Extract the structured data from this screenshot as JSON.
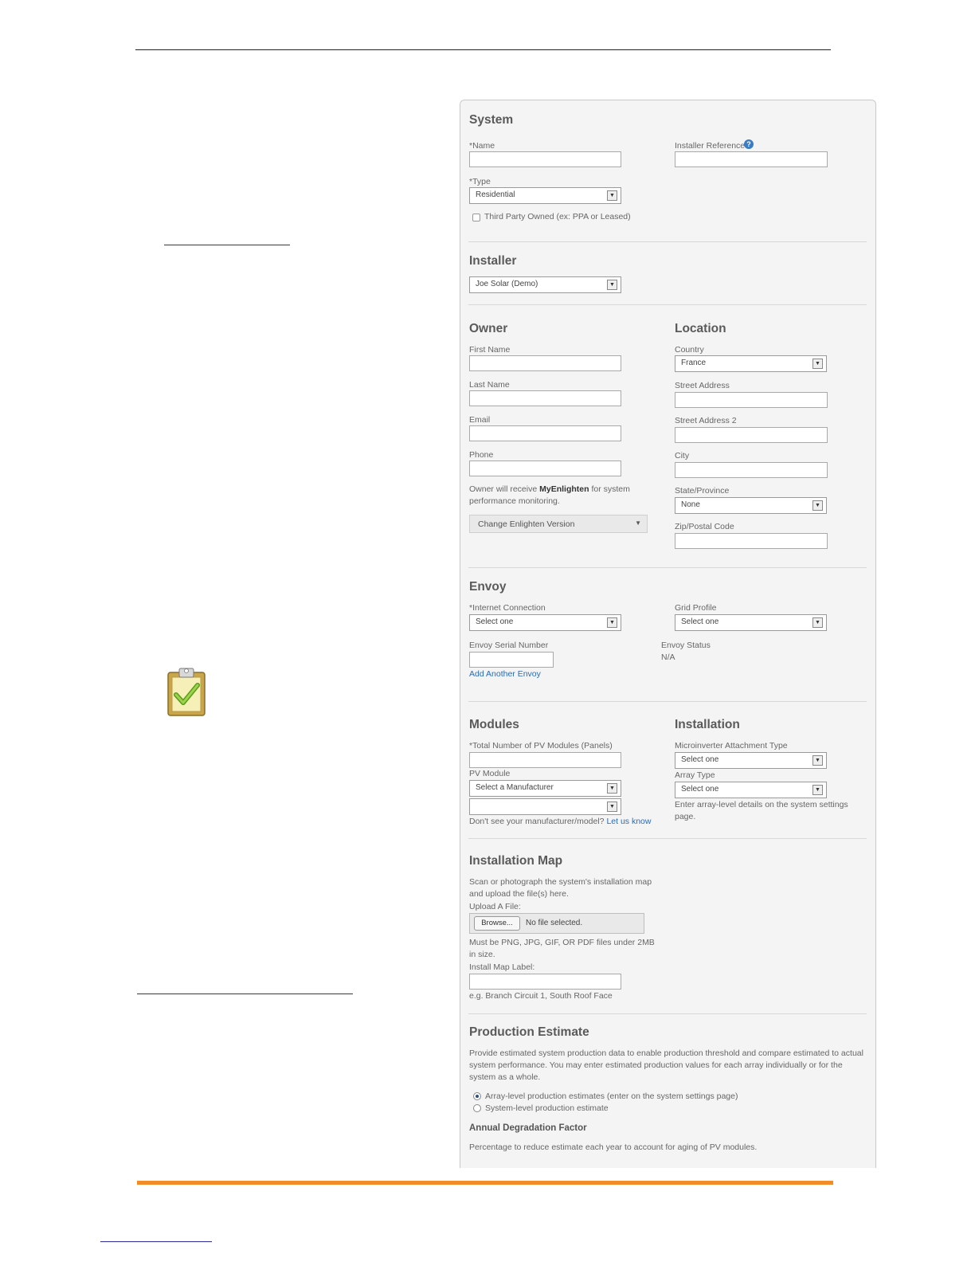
{
  "form": {
    "system": {
      "title": "System",
      "name_label": "*Name",
      "installer_ref_label": "Installer Reference",
      "type_label": "*Type",
      "type_value": "Residential",
      "third_party_label": "Third Party Owned (ex: PPA or Leased)"
    },
    "installer": {
      "title": "Installer",
      "value": "Joe Solar (Demo)"
    },
    "owner": {
      "title": "Owner",
      "first_name_label": "First Name",
      "last_name_label": "Last Name",
      "email_label": "Email",
      "phone_label": "Phone",
      "note_prefix": "Owner will receive ",
      "note_brand": "MyEnlighten",
      "note_suffix": " for system performance monitoring.",
      "change_version_label": "Change Enlighten Version"
    },
    "location": {
      "title": "Location",
      "country_label": "Country",
      "country_value": "France",
      "street_label": "Street Address",
      "street2_label": "Street Address 2",
      "city_label": "City",
      "state_label": "State/Province",
      "state_value": "None",
      "zip_label": "Zip/Postal Code"
    },
    "envoy": {
      "title": "Envoy",
      "internet_label": "*Internet Connection",
      "internet_value": "Select one",
      "grid_label": "Grid Profile",
      "grid_value": "Select one",
      "serial_label": "Envoy Serial Number",
      "status_label": "Envoy Status",
      "status_value": "N/A",
      "add_link": "Add Another Envoy"
    },
    "modules": {
      "title": "Modules",
      "total_label": "*Total Number of PV Modules (Panels)",
      "pv_label": "PV Module",
      "manufacturer_value": "Select a Manufacturer",
      "note": "Don't see your manufacturer/model?",
      "let_us_know": "Let us know"
    },
    "installation": {
      "title": "Installation",
      "attachment_label": "Microinverter Attachment Type",
      "attachment_value": "Select one",
      "array_label": "Array Type",
      "array_value": "Select one",
      "note": "Enter array-level details on the system settings page."
    },
    "installation_map": {
      "title": "Installation Map",
      "desc": "Scan or photograph the system's installation map and upload the file(s) here.",
      "upload_label": "Upload A File:",
      "browse_label": "Browse...",
      "no_file": "No file selected.",
      "size_note": "Must be PNG, JPG, GIF, OR PDF files under 2MB in size.",
      "map_label": "Install Map Label:",
      "example": "e.g. Branch Circuit 1, South Roof Face"
    },
    "production": {
      "title": "Production Estimate",
      "desc": "Provide estimated system production data to enable production threshold and compare estimated to actual system performance. You may enter estimated production values for each array individually or for the system as a whole.",
      "opt_array": "Array-level production estimates (enter on the system settings page)",
      "opt_system": "System-level production estimate",
      "degradation_title": "Annual Degradation Factor",
      "degradation_desc": "Percentage to reduce estimate each year to account for aging of PV modules."
    }
  },
  "colors": {
    "accent_orange": "#f28c28",
    "link_blue": "#2a6bb5",
    "clipboard_green": "#8cc63f"
  }
}
